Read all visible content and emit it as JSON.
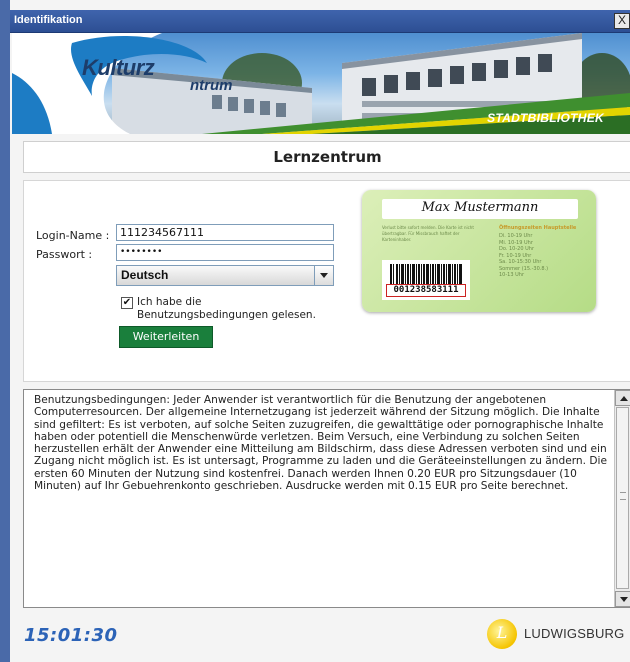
{
  "window": {
    "title": "Identifikation",
    "close_glyph": "X"
  },
  "banner": {
    "logo_text_1": "Kulturz",
    "logo_text_2": "ntrum",
    "stadtbibliothek": "STADTBIBLIOTHEK"
  },
  "heading": "Lernzentrum",
  "login": {
    "login_label": "Login-Name :",
    "login_value": "111234567111",
    "password_label": "Passwort :",
    "password_value": "••••••••",
    "language_selected": "Deutsch",
    "agree_checked": true,
    "agree_label": "Ich habe die Benutzungsbedingungen gelesen.",
    "submit_label": "Weiterleiten"
  },
  "card": {
    "name": "Max Mustermann",
    "small_text": "Verlust bitte sofort melden. Die Karte ist nicht übertragbar. Für Missbrauch haftet der Karteninhaber.",
    "hours_title": "Öffnungszeiten Hauptstelle",
    "hours": [
      "Di. 10-19 Uhr",
      "Mi. 10-19 Uhr",
      "Do. 10-20 Uhr",
      "Fr. 10-19 Uhr",
      "Sa. 10-15:30 Uhr",
      "Sommer (15.-30.8.)",
      "10-13 Uhr"
    ],
    "barcode_number": "001238583111"
  },
  "terms": {
    "text": "Benutzungsbedingungen: Jeder Anwender ist verantwortlich für die Benutzung der angebotenen Computerresourcen. Der allgemeine Internetzugang ist jederzeit während der Sitzung möglich. Die Inhalte sind gefiltert: Es ist verboten, auf solche Seiten zuzugreifen, die gewalttätige oder pornographische Inhalte haben oder potentiell die Menschenwürde verletzen. Beim Versuch, eine Verbindung zu solchen Seiten herzustellen erhält der Anwender eine Mitteilung am Bildschirm, dass diese Adressen verboten sind und ein Zugang nicht möglich ist. Es ist untersagt, Programme zu laden und die Geräteeinstellungen zu ändern. Die ersten 60 Minuten der Nutzung sind kostenfrei. Danach werden Ihnen 0.20 EUR pro Sitzungsdauer (10 Minuten) auf Ihr Gebuehrenkonto geschrieben. Ausdrucke werden mit 0.15 EUR pro Seite berechnet."
  },
  "footer": {
    "clock": "15:01:30",
    "logo_glyph": "L",
    "city": "LUDWIGSBURG"
  },
  "colors": {
    "title_bar": "#3f64ad",
    "button_green": "#1a7f3c",
    "clock_blue": "#2c63b7",
    "banner_green": "#3f8f2f",
    "banner_yellow": "#e2d400"
  }
}
